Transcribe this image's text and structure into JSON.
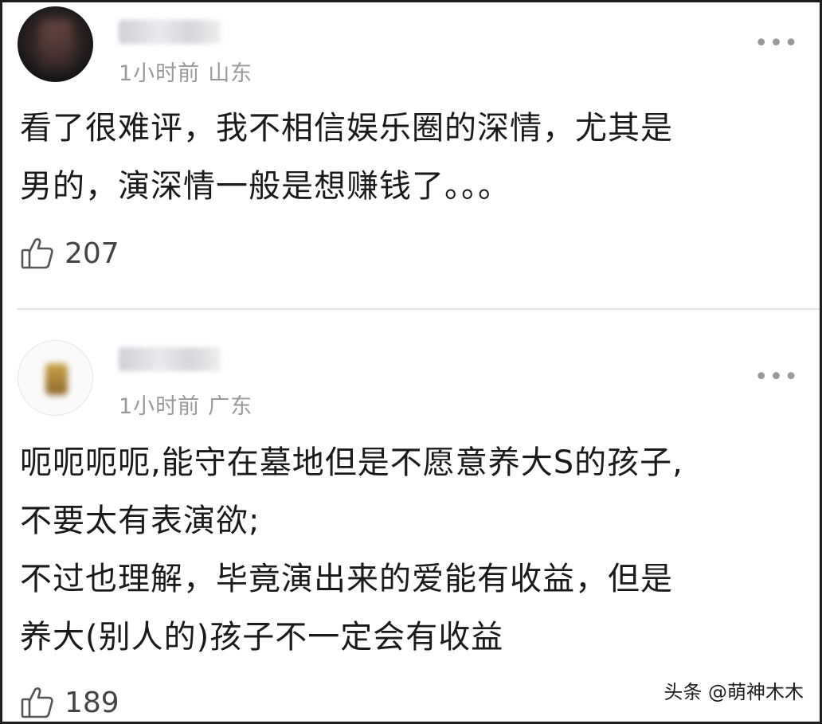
{
  "comments": [
    {
      "time": "1小时前",
      "location": "山东",
      "text": "看了很难评，我不相信娱乐圈的深情，尤其是\n男的，演深情一般是想赚钱了。。。",
      "likes": "207",
      "avatar_icon": "user-avatar-blurred",
      "more_icon": "more-dots-icon"
    },
    {
      "time": "1小时前",
      "location": "广东",
      "text": "呃呃呃呃,能守在墓地但是不愿意养大S的孩子,\n不要太有表演欲;\n不过也理解，毕竟演出来的爱能有收益，但是\n养大(别人的)孩子不一定会有收益",
      "likes": "189",
      "avatar_icon": "user-avatar-blurred",
      "more_icon": "more-dots-icon"
    }
  ],
  "more_glyph": "•••",
  "like_icon": "thumbs-up-icon",
  "watermark": "头条 @萌神木木"
}
